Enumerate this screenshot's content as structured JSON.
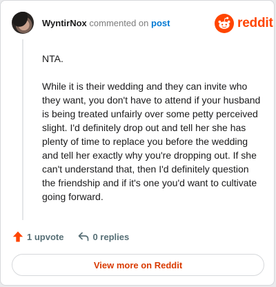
{
  "colors": {
    "brand": "#ff4500",
    "link": "#0079d3",
    "muted": "#576f76",
    "view_more": "#d93a00"
  },
  "header": {
    "username": "WyntirNox",
    "action_text": "commented on",
    "post_link": "post"
  },
  "brand": {
    "logo_icon": "reddit-alien-icon",
    "name": "reddit"
  },
  "comment": {
    "paragraphs": [
      "NTA.",
      "While it is their wedding and they can invite who they want, you don't have to attend if your husband is being treated unfairly over some petty perceived slight. I'd definitely drop out and tell her she has plenty of time to replace you before the wedding and tell her exactly why you're dropping out. If she can't understand that, then I'd definitely question the friendship and if it's one you'd want to cultivate going forward."
    ]
  },
  "actions": {
    "upvote_icon": "upvote-arrow-icon",
    "upvote_label": "1 upvote",
    "reply_icon": "reply-arrow-icon",
    "reply_label": "0 replies"
  },
  "footer": {
    "view_more_label": "View more on Reddit"
  }
}
